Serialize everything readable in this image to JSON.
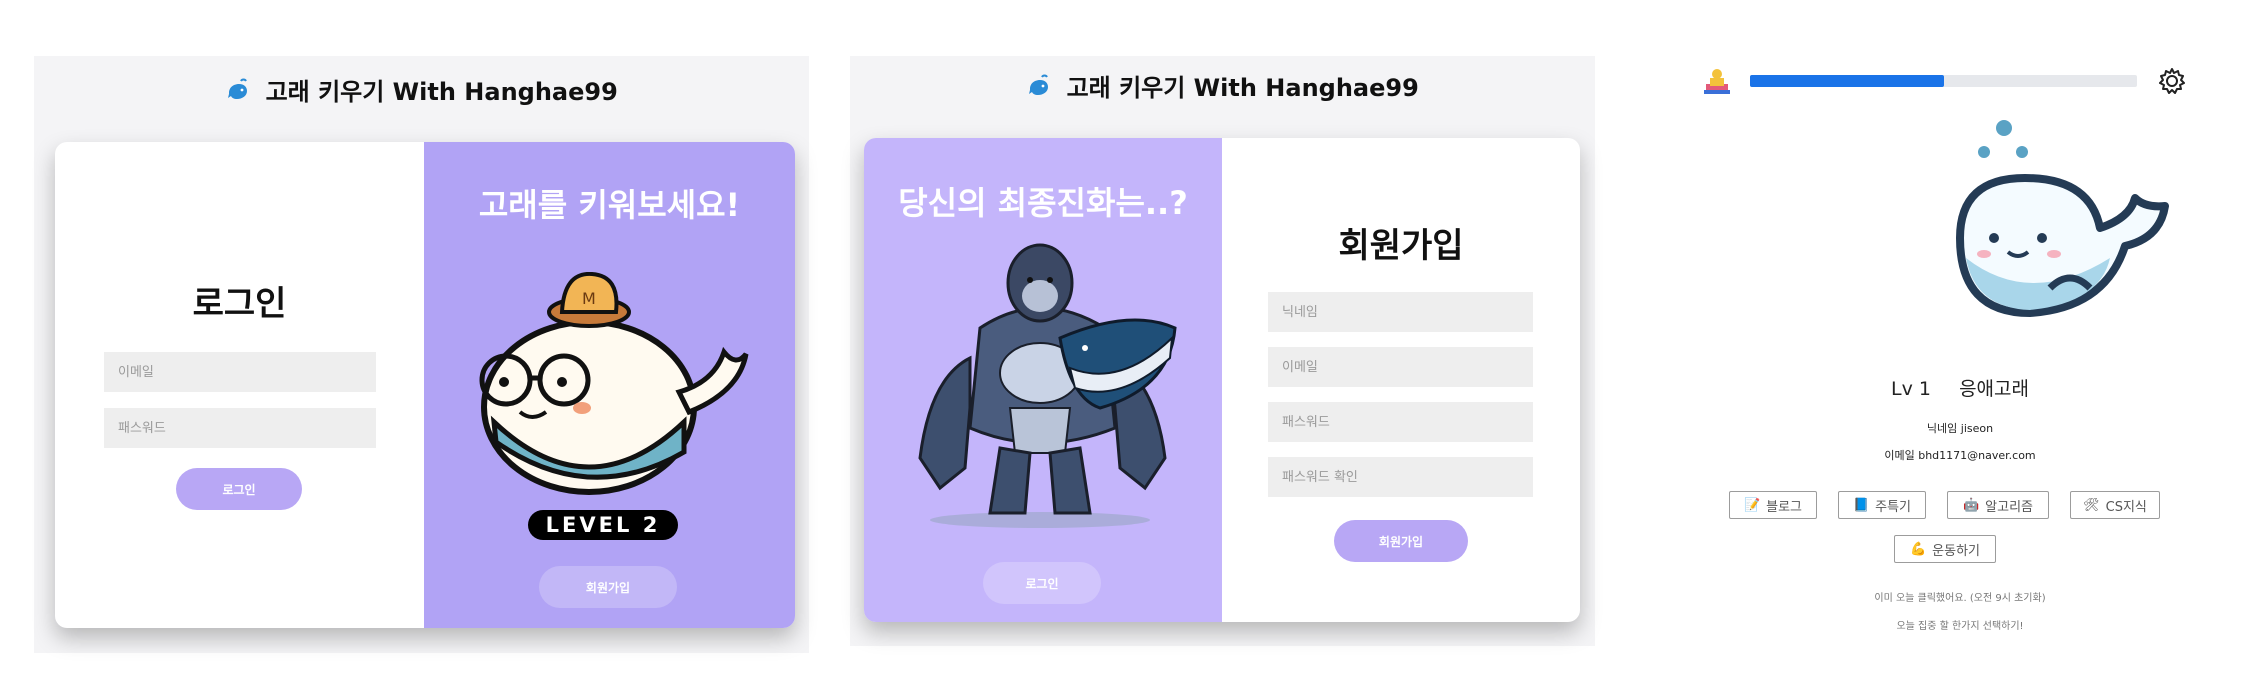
{
  "app": {
    "title": "고래 키우기 With Hanghae99"
  },
  "login": {
    "heading": "로그인",
    "email_placeholder": "이메일",
    "password_placeholder": "패스워드",
    "login_button": "로그인",
    "promo_title": "고래를 키워보세요!",
    "level_badge": "LEVEL 2",
    "signup_button": "회원가입"
  },
  "signup": {
    "promo_title": "당신의 최종진화는..?",
    "heading": "회원가입",
    "nickname_placeholder": "닉네임",
    "email_placeholder": "이메일",
    "password_placeholder": "패스워드",
    "password_confirm_placeholder": "패스워드 확인",
    "signup_button": "회원가입",
    "login_button": "로그인"
  },
  "profile": {
    "progress": 0.5,
    "level": "Lv 1",
    "whale_name": "응애고래",
    "nickname_label": "닉네임",
    "nickname_value": "jiseon",
    "email_label": "이메일",
    "email_value": "bhd1171@naver.com",
    "categories": [
      {
        "icon": "memo-icon",
        "label": "블로그"
      },
      {
        "icon": "book-icon",
        "label": "주특기"
      },
      {
        "icon": "robot-icon",
        "label": "알고리즘"
      },
      {
        "icon": "tools-icon",
        "label": "CS지식"
      },
      {
        "icon": "flexed-biceps-icon",
        "label": "운동하기"
      }
    ],
    "note_line1": "이미 오늘 클릭했어요. (오전 9시 초기화)",
    "note_line2": "오늘 집중 할 한가지 선택하기!"
  },
  "colors": {
    "purple": "#b1a3f5",
    "purple_light": "#c4b5fb",
    "progress": "#1a73e8"
  }
}
